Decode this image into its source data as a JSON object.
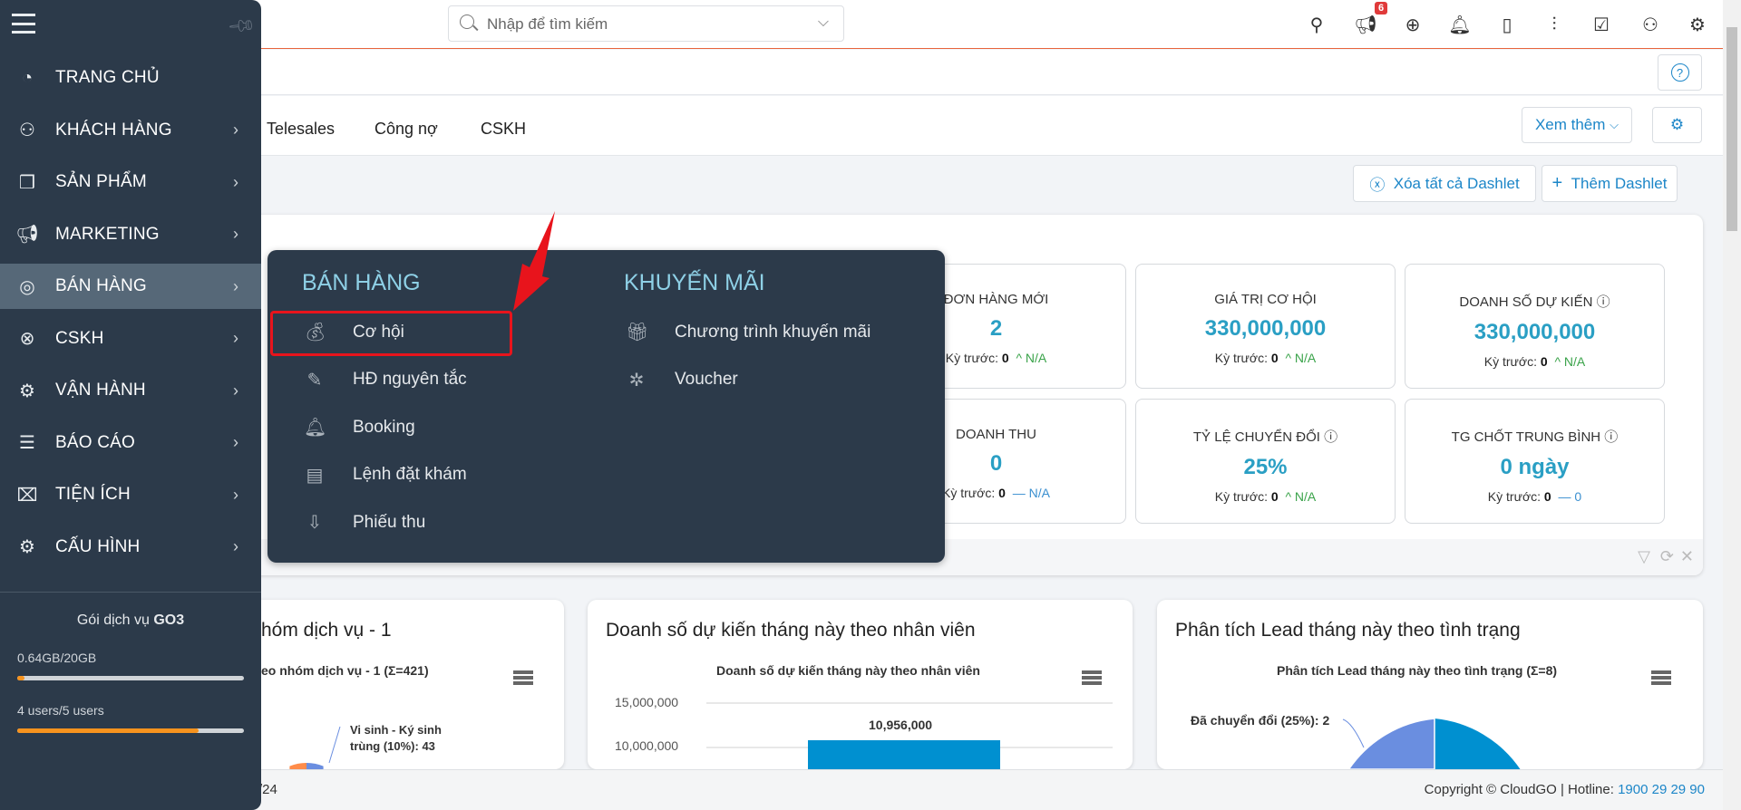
{
  "topbar": {
    "search_placeholder": "Nhập để tìm kiếm",
    "notification_count": "6",
    "icons": [
      "map-pin-icon",
      "megaphone-icon",
      "plus-circle-icon",
      "bell-icon",
      "calendar-icon",
      "chart-icon",
      "checkbox-icon",
      "user-icon",
      "gear-icon"
    ]
  },
  "tabs": [
    "Telesales",
    "Công nợ",
    "CSKH"
  ],
  "toolbar": {
    "more_label": "Xem thêm",
    "clear_dashlets": "Xóa tất cả Dashlet",
    "add_dashlet": "Thêm Dashlet"
  },
  "sidebar": {
    "items": [
      {
        "label": "TRANG CHỦ",
        "icon": "dashboard-icon"
      },
      {
        "label": "KHÁCH HÀNG",
        "icon": "users-icon"
      },
      {
        "label": "SẢN PHẨM",
        "icon": "boxes-icon"
      },
      {
        "label": "MARKETING",
        "icon": "megaphone-icon"
      },
      {
        "label": "BÁN HÀNG",
        "icon": "target-icon",
        "active": true
      },
      {
        "label": "CSKH",
        "icon": "lifebuoy-icon"
      },
      {
        "label": "VẬN HÀNH",
        "icon": "gears-icon"
      },
      {
        "label": "BÁO CÁO",
        "icon": "report-icon"
      },
      {
        "label": "TIỆN ÍCH",
        "icon": "toolbox-icon"
      },
      {
        "label": "CẤU HÌNH",
        "icon": "gear-icon"
      }
    ],
    "plan_label": "Gói dịch vụ",
    "plan_name": "GO3",
    "storage_text": "0.64GB/20GB",
    "storage_fraction": 0.032,
    "users_text": "4 users/5 users",
    "users_fraction": 0.8,
    "accent": "#f7931e"
  },
  "popup": {
    "sales_heading": "BÁN HÀNG",
    "sales_items": [
      "Cơ hội",
      "HĐ nguyên tắc",
      "Booking",
      "Lệnh đặt khám",
      "Phiếu thu"
    ],
    "promo_heading": "KHUYẾN MÃI",
    "promo_items": [
      "Chương trình khuyến mãi",
      "Voucher"
    ],
    "highlighted": "Cơ hội"
  },
  "stats": [
    {
      "label": "ĐƠN HÀNG MỚI",
      "value": "2",
      "prev_label": "Kỳ trước:",
      "prev": "0",
      "change": "N/A",
      "trend": "up"
    },
    {
      "label": "GIÁ TRỊ CƠ HỘI",
      "value": "330,000,000",
      "prev_label": "Kỳ trước:",
      "prev": "0",
      "change": "N/A",
      "trend": "up"
    },
    {
      "label": "DOANH SỐ DỰ KIẾN",
      "value": "330,000,000",
      "prev_label": "Kỳ trước:",
      "prev": "0",
      "change": "N/A",
      "trend": "up"
    },
    {
      "label": "DOANH THU",
      "value": "0",
      "prev_label": "Kỳ trước:",
      "prev": "0",
      "change": "N/A",
      "trend": "flat"
    },
    {
      "label": "TỶ LỆ CHUYỂN ĐỔI",
      "value": "25%",
      "prev_label": "Kỳ trước:",
      "prev": "0",
      "change": "N/A",
      "trend": "up"
    },
    {
      "label": "TG CHỐT TRUNG BÌNH",
      "value": "0 ngày",
      "prev_label": "Kỳ trước:",
      "prev": "0",
      "change": "0",
      "trend": "flat"
    }
  ],
  "charts": {
    "c1": {
      "title": "hóm dịch vụ - 1",
      "subtitle": "eo nhóm dịch vụ - 1 (Σ=421)",
      "label": "Vi sinh - Ký sinh trùng (10%): 43"
    },
    "c2": {
      "title": "Doanh số dự kiến tháng này theo nhân viên",
      "subtitle": "Doanh số dự kiến tháng này theo nhân viên",
      "ticks": [
        "15,000,000",
        "10,000,000"
      ],
      "bar_label": "10,956,000"
    },
    "c3": {
      "title": "Phân tích Lead tháng này theo tình trạng",
      "subtitle": "Phân tích Lead tháng này theo tình trạng (Σ=8)",
      "label": "Đã chuyển đổi (25%): 2"
    }
  },
  "chart_data": [
    {
      "type": "pie",
      "title": "Phân tích Lead tháng này theo tình trạng (Σ=8)",
      "slices": [
        {
          "label": "Đã chuyển đổi",
          "percent": 25,
          "value": 2,
          "color": "#6a8ee0"
        }
      ],
      "total": 8
    },
    {
      "type": "bar",
      "title": "Doanh số dự kiến tháng này theo nhân viên",
      "values": [
        10956000
      ],
      "ylim": [
        0,
        15000000
      ],
      "color": "#0090d0"
    }
  ],
  "footer": {
    "left_fragment": "/24",
    "copyright": "Copyright © CloudGO",
    "hotline_label": "Hotline:",
    "hotline": "1900 29 29 90"
  }
}
